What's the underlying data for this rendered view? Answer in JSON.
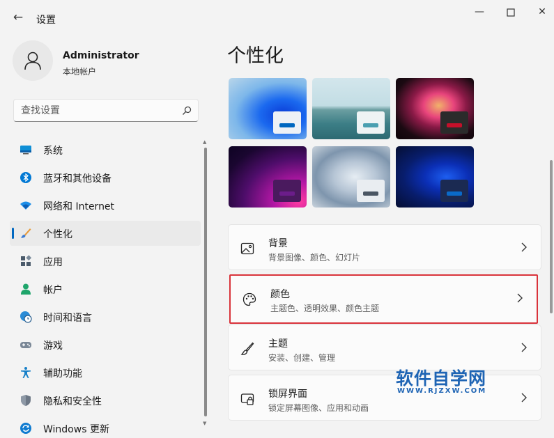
{
  "window": {
    "title": "设置",
    "back_icon": "arrow-left-icon",
    "controls": [
      "minimize-icon",
      "maximize-icon",
      "close-icon"
    ]
  },
  "profile": {
    "name": "Administrator",
    "account_type": "本地帐户"
  },
  "search": {
    "placeholder": "查找设置",
    "value": ""
  },
  "sidebar": {
    "items": [
      {
        "label": "系统",
        "icon": "system-icon"
      },
      {
        "label": "蓝牙和其他设备",
        "icon": "bluetooth-icon"
      },
      {
        "label": "网络和 Internet",
        "icon": "wifi-icon"
      },
      {
        "label": "个性化",
        "icon": "brush-icon",
        "active": true
      },
      {
        "label": "应用",
        "icon": "apps-icon"
      },
      {
        "label": "帐户",
        "icon": "account-icon"
      },
      {
        "label": "时间和语言",
        "icon": "globe-clock-icon"
      },
      {
        "label": "游戏",
        "icon": "gamepad-icon"
      },
      {
        "label": "辅助功能",
        "icon": "accessibility-icon"
      },
      {
        "label": "隐私和安全性",
        "icon": "shield-icon"
      },
      {
        "label": "Windows 更新",
        "icon": "update-icon"
      }
    ]
  },
  "main": {
    "page_title": "个性化",
    "themes": [
      {
        "name": "theme-light-bloom",
        "accent": "#0067c0"
      },
      {
        "name": "theme-glow",
        "accent": "#4a9fb0"
      },
      {
        "name": "theme-captured-motion",
        "accent": "#c4102a"
      },
      {
        "name": "theme-dark-bloom-purple",
        "accent": "#6b1d8a"
      },
      {
        "name": "theme-flow",
        "accent": "#4a5663"
      },
      {
        "name": "theme-dark-bloom",
        "accent": "#0a6ac8"
      }
    ],
    "settings": [
      {
        "title": "背景",
        "subtitle": "背景图像、颜色、幻灯片",
        "icon": "image-icon"
      },
      {
        "title": "颜色",
        "subtitle": "主题色、透明效果、颜色主题",
        "icon": "palette-icon",
        "highlighted": true
      },
      {
        "title": "主题",
        "subtitle": "安装、创建、管理",
        "icon": "brush-icon"
      },
      {
        "title": "锁屏界面",
        "subtitle": "锁定屏幕图像、应用和动画",
        "icon": "lock-screen-icon"
      }
    ]
  },
  "watermark": {
    "text": "软件自学网",
    "url": "WWW.RJZXW.COM"
  },
  "colors": {
    "accent": "#0067c0",
    "highlight_border": "#d9323a",
    "background": "#f3f3f3",
    "card": "#fbfbfb"
  }
}
